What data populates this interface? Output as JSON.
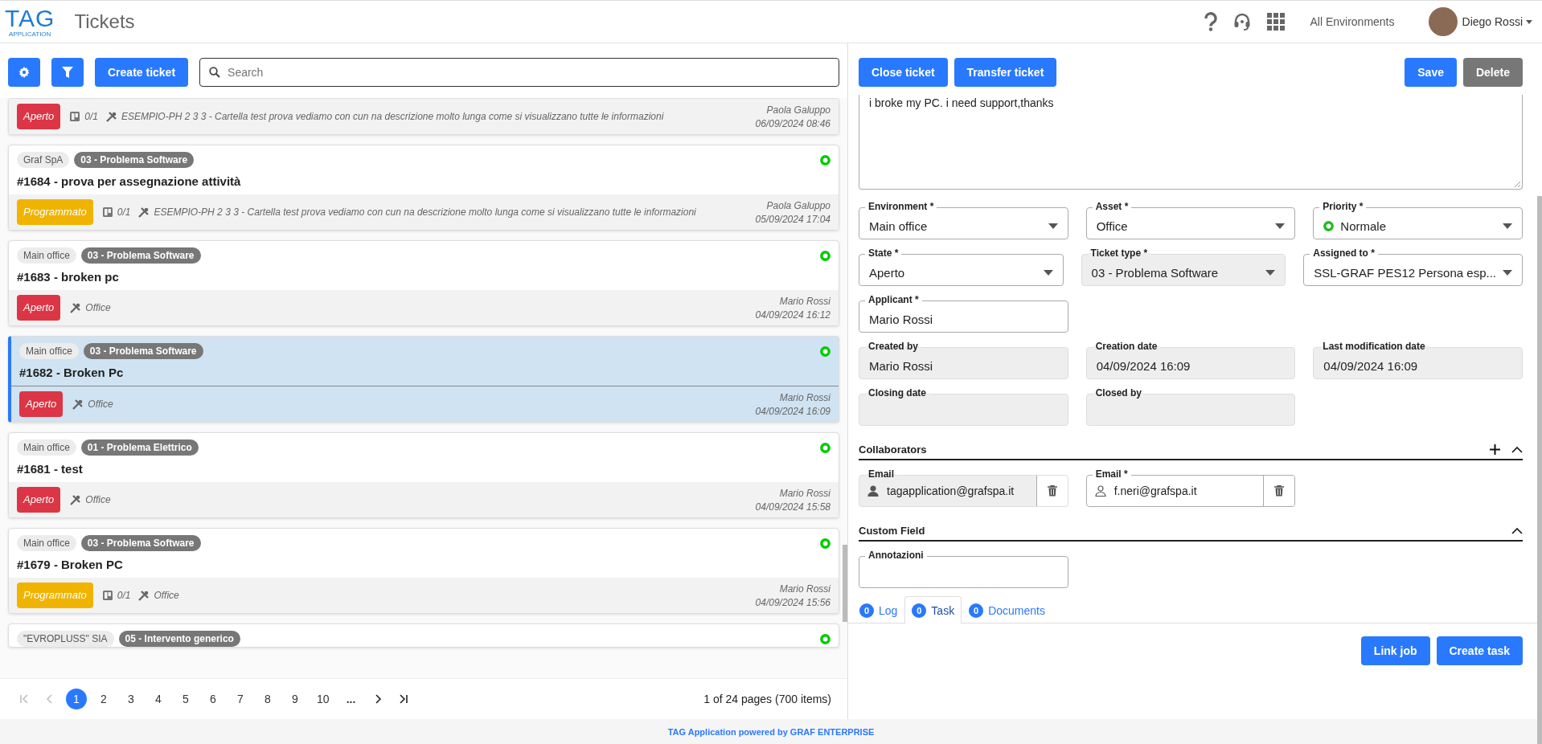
{
  "header": {
    "logo": "TAG",
    "logo_sub": "APPLICATION",
    "title": "Tickets",
    "environment": "All Environments",
    "user": "Diego Rossi"
  },
  "list_toolbar": {
    "create_button": "Create ticket",
    "search": {
      "placeholder": "Search"
    }
  },
  "tickets": [
    {
      "status": "Aperto",
      "color": "#dc3545",
      "tasks": "0/1",
      "asset": "ESEMPIO-PH 2 3 3 - Cartella test prova vediamo con cun na descrizione molto lunga come si visualizzano tutte le informazioni",
      "author": "Paola Galuppo",
      "date": "06/09/2024 08:46",
      "selected": false
    },
    {
      "org": "Graf SpA",
      "type": "03 - Problema Software",
      "title": "#1684 - prova per assegnazione attività",
      "status": "Programmato",
      "color": "#f0b400",
      "tasks": "0/1",
      "asset": "ESEMPIO-PH 2 3 3 - Cartella test prova vediamo con cun na descrizione molto lunga come si visualizzano tutte le informazioni",
      "author": "Paola Galuppo",
      "date": "05/09/2024 17:04",
      "selected": false
    },
    {
      "org": "Main office",
      "type": "03 - Problema Software",
      "title": "#1683 - broken pc",
      "status": "Aperto",
      "color": "#dc3545",
      "asset": "Office",
      "author": "Mario Rossi",
      "date": "04/09/2024 16:12",
      "selected": false
    },
    {
      "org": "Main office",
      "type": "03 - Problema Software",
      "title": "#1682 - Broken Pc",
      "status": "Aperto",
      "color": "#dc3545",
      "asset": "Office",
      "author": "Mario Rossi",
      "date": "04/09/2024 16:09",
      "selected": true
    },
    {
      "org": "Main office",
      "type": "01 - Problema Elettrico",
      "title": "#1681 - test",
      "status": "Aperto",
      "color": "#dc3545",
      "asset": "Office",
      "author": "Mario Rossi",
      "date": "04/09/2024 15:58",
      "selected": false
    },
    {
      "org": "Main office",
      "type": "03 - Problema Software",
      "title": "#1679 - Broken PC",
      "status": "Programmato",
      "color": "#f0b400",
      "tasks": "0/1",
      "asset": "Office",
      "author": "Mario Rossi",
      "date": "04/09/2024 15:56",
      "selected": false
    },
    {
      "org": "\"EVROPLUSS\" SIA",
      "type": "05 - Intervento generico",
      "selected": false
    }
  ],
  "pagination": {
    "pages": [
      {
        "label": "1",
        "selected": true
      },
      {
        "label": "2",
        "selected": false
      },
      {
        "label": "3",
        "selected": false
      },
      {
        "label": "4",
        "selected": false
      },
      {
        "label": "5",
        "selected": false
      },
      {
        "label": "6",
        "selected": false
      },
      {
        "label": "7",
        "selected": false
      },
      {
        "label": "8",
        "selected": false
      },
      {
        "label": "9",
        "selected": false
      },
      {
        "label": "10",
        "selected": false
      }
    ],
    "ellipsis": "...",
    "summary": "1 of 24 pages (700 items)"
  },
  "detail_toolbar": {
    "left_buttons": [
      "Close ticket",
      "Transfer ticket"
    ],
    "save": "Save",
    "delete": "Delete"
  },
  "description": "i broke my PC. i need support,thanks",
  "fields": [
    [
      {
        "label": "Environment *",
        "value": "Main office",
        "kind": "select",
        "disabled": false
      },
      {
        "label": "Asset *",
        "value": "Office",
        "kind": "select",
        "disabled": false
      },
      {
        "label": "Priority *",
        "value": "Normale",
        "kind": "select",
        "disabled": false,
        "color": "#22bb22"
      }
    ],
    [
      {
        "label": "State *",
        "value": "Aperto",
        "kind": "select",
        "disabled": false
      },
      {
        "label": "Ticket type *",
        "value": "03 - Problema Software",
        "kind": "select",
        "disabled": true
      },
      {
        "label": "Assigned to *",
        "value": "SSL-GRAF PES12 Persona esp...",
        "kind": "select",
        "disabled": false
      }
    ],
    [
      {
        "label": "Applicant *",
        "value": "Mario Rossi",
        "kind": "input",
        "disabled": false
      }
    ],
    [
      {
        "label": "Created by",
        "value": "Mario Rossi",
        "kind": "input",
        "disabled": true
      },
      {
        "label": "Creation date",
        "value": "04/09/2024 16:09",
        "kind": "input",
        "disabled": true
      },
      {
        "label": "Last modification date",
        "value": "04/09/2024 16:09",
        "kind": "input",
        "disabled": true
      }
    ],
    [
      {
        "label": "Closing date",
        "kind": "input",
        "disabled": true
      },
      {
        "label": "Closed by",
        "kind": "input",
        "disabled": true
      }
    ]
  ],
  "collaborators": {
    "title": "Collaborators",
    "emails": [
      {
        "label": "Email",
        "value": "tagapplication@grafspa.it",
        "disabled": true
      },
      {
        "label": "Email *",
        "value": "f.neri@grafspa.it",
        "disabled": false
      }
    ]
  },
  "custom_field": {
    "title": "Custom Field",
    "fields": [
      {
        "label": "Annotazioni"
      }
    ]
  },
  "tabs": [
    {
      "label": "Log",
      "count": "0",
      "selected": false
    },
    {
      "label": "Task",
      "count": "0",
      "selected": true
    },
    {
      "label": "Documents",
      "count": "0",
      "selected": false
    }
  ],
  "tab_buttons": [
    "Link job",
    "Create task"
  ],
  "footer": "TAG Application powered by GRAF ENTERPRISE"
}
